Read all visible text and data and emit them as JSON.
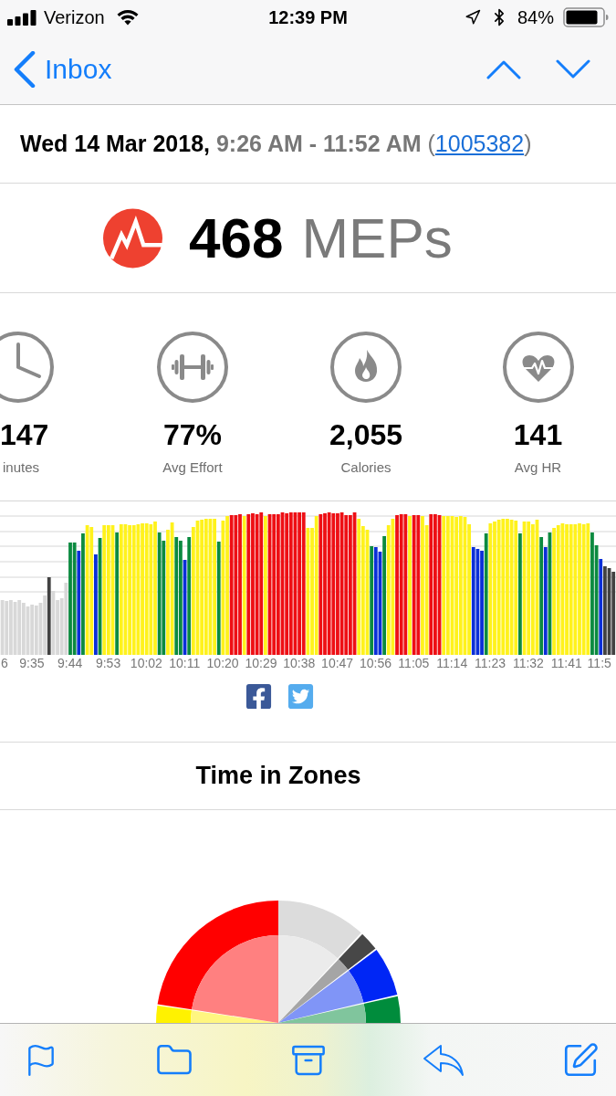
{
  "status_bar": {
    "carrier": "Verizon",
    "time": "12:39 PM",
    "battery": "84%"
  },
  "nav_bar": {
    "back_label": "Inbox"
  },
  "header": {
    "date": "Wed 14 Mar 2018,",
    "time_range": "9:26 AM - 11:52 AM",
    "link_open": "(",
    "link": "1005382",
    "link_close": ")"
  },
  "summary": {
    "value": "468",
    "unit": "MEPs"
  },
  "stats": [
    {
      "value": "147",
      "label": "inutes"
    },
    {
      "value": "77%",
      "label": "Avg Effort"
    },
    {
      "value": "2,055",
      "label": "Calories"
    },
    {
      "value": "141",
      "label": "Avg HR"
    }
  ],
  "effort_chart": {
    "x_labels": [
      "6",
      "9:35",
      "9:44",
      "9:53",
      "10:02",
      "10:11",
      "10:20",
      "10:29",
      "10:38",
      "10:47",
      "10:56",
      "11:05",
      "11:14",
      "11:23",
      "11:32",
      "11:41",
      "11:5"
    ]
  },
  "zones": {
    "title": "Time in Zones"
  }
}
